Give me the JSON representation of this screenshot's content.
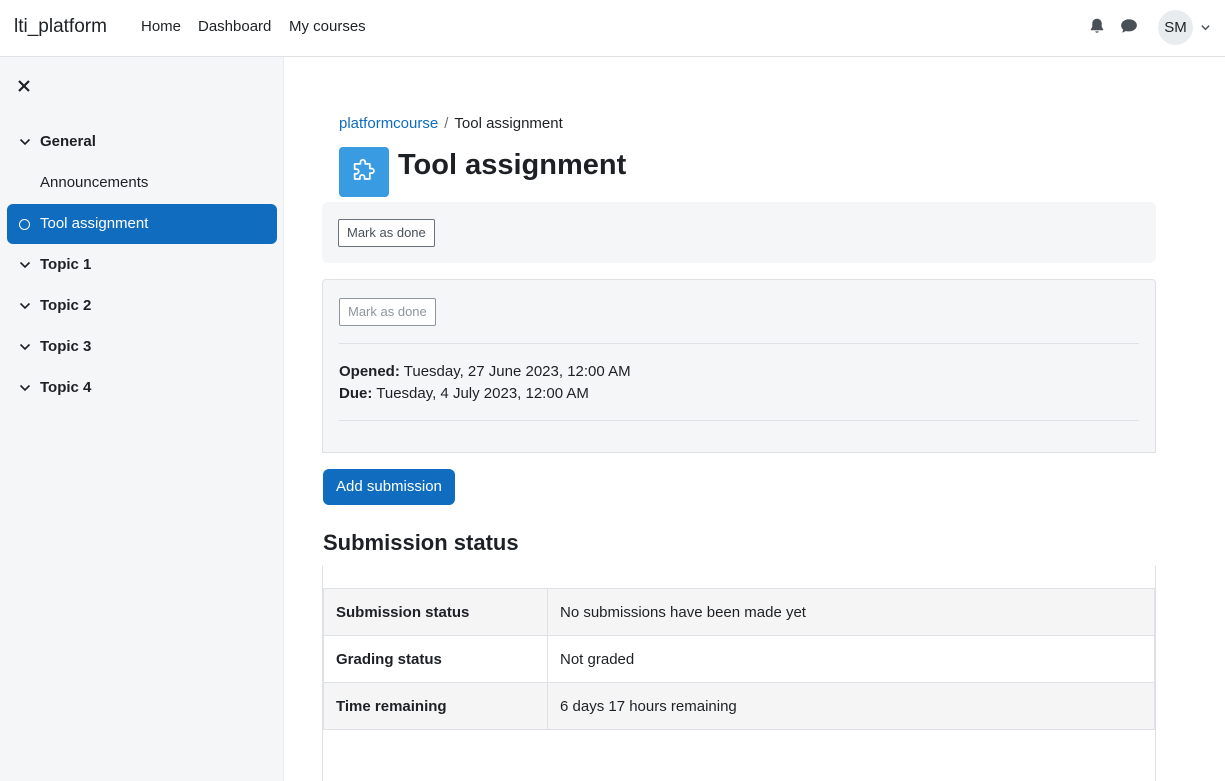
{
  "navbar": {
    "brand": "lti_platform",
    "links": [
      "Home",
      "Dashboard",
      "My courses"
    ],
    "user_initials": "SM"
  },
  "drawer": {
    "items": [
      {
        "label": "General",
        "type": "section"
      },
      {
        "label": "Announcements",
        "type": "activity"
      },
      {
        "label": "Tool assignment",
        "type": "activity",
        "active": true
      },
      {
        "label": "Topic 1",
        "type": "section"
      },
      {
        "label": "Topic 2",
        "type": "section"
      },
      {
        "label": "Topic 3",
        "type": "section"
      },
      {
        "label": "Topic 4",
        "type": "section"
      }
    ]
  },
  "breadcrumb": {
    "course": "platformcourse",
    "separator": "/",
    "current": "Tool assignment"
  },
  "page": {
    "title": "Tool assignment",
    "icon": "puzzle-icon"
  },
  "completion": {
    "mark_done_label": "Mark as done",
    "mark_done_label_disabled": "Mark as done"
  },
  "dates": {
    "opened_label": "Opened:",
    "opened_value": " Tuesday, 27 June 2023, 12:00 AM",
    "due_label": "Due:",
    "due_value": " Tuesday, 4 July 2023, 12:00 AM"
  },
  "actions": {
    "add_submission": "Add submission"
  },
  "submission": {
    "heading": "Submission status",
    "rows": [
      {
        "key": "Submission status",
        "value": "No submissions have been made yet"
      },
      {
        "key": "Grading status",
        "value": "Not graded"
      },
      {
        "key": "Time remaining",
        "value": "6 days 17 hours remaining"
      }
    ]
  },
  "colors": {
    "primary": "#0f6cbf",
    "activity_icon": "#399be2",
    "drawer_bg": "#f5f6f7"
  }
}
